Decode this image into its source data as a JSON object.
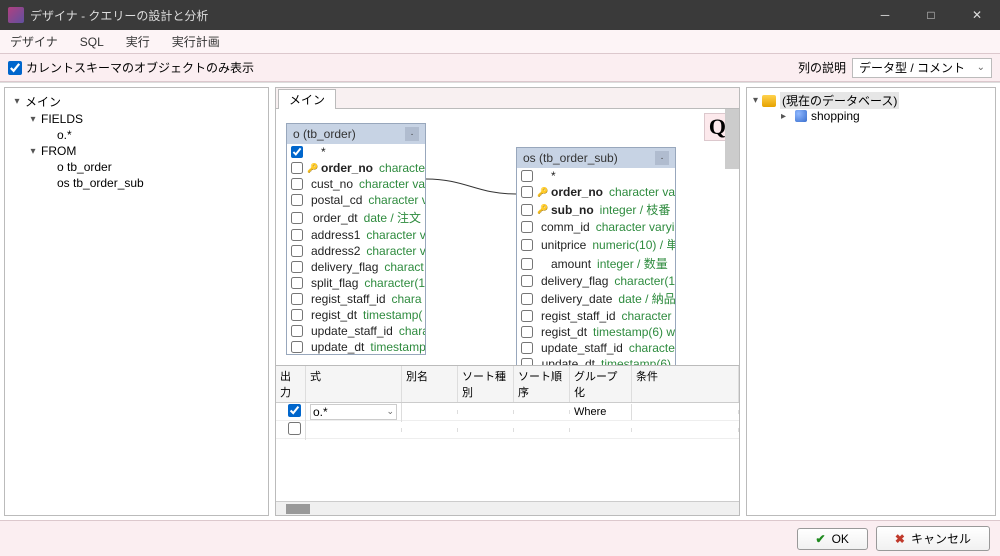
{
  "window": {
    "title": "デザイナ - クエリーの設計と分析"
  },
  "menu": {
    "designer": "デザイナ",
    "sql": "SQL",
    "run": "実行",
    "plan": "実行計画"
  },
  "toolbar": {
    "show_current_schema": "カレントスキーマのオブジェクトのみ表示",
    "column_desc_label": "列の説明",
    "column_desc_value": "データ型 / コメント"
  },
  "left_tree": {
    "main": "メイン",
    "fields": "FIELDS",
    "ostar": "o.*",
    "from": "FROM",
    "t1": "o tb_order",
    "t2": "os tb_order_sub"
  },
  "center": {
    "tab": "メイン"
  },
  "card_o": {
    "header": "o (tb_order)",
    "cols": [
      {
        "name": "*",
        "type": "",
        "key": false,
        "checked": true
      },
      {
        "name": "order_no",
        "type": "character v",
        "key": true,
        "bold": true
      },
      {
        "name": "cust_no",
        "type": "character va",
        "key": false
      },
      {
        "name": "postal_cd",
        "type": "character v",
        "key": false
      },
      {
        "name": "order_dt",
        "type": "date / 注文",
        "key": false
      },
      {
        "name": "address1",
        "type": "character v",
        "key": false
      },
      {
        "name": "address2",
        "type": "character v",
        "key": false
      },
      {
        "name": "delivery_flag",
        "type": "charact",
        "key": false
      },
      {
        "name": "split_flag",
        "type": "character(1",
        "key": false
      },
      {
        "name": "regist_staff_id",
        "type": "chara",
        "key": false
      },
      {
        "name": "regist_dt",
        "type": "timestamp(",
        "key": false
      },
      {
        "name": "update_staff_id",
        "type": "chara",
        "key": false
      },
      {
        "name": "update_dt",
        "type": "timestamp",
        "key": false
      }
    ]
  },
  "card_os": {
    "header": "os (tb_order_sub)",
    "cols": [
      {
        "name": "*",
        "type": "",
        "key": false
      },
      {
        "name": "order_no",
        "type": "character vary",
        "key": true,
        "bold": true
      },
      {
        "name": "sub_no",
        "type": "integer / 枝番",
        "key": true,
        "bold": true
      },
      {
        "name": "comm_id",
        "type": "character varyi",
        "key": false
      },
      {
        "name": "unitprice",
        "type": "numeric(10) / 単",
        "key": false
      },
      {
        "name": "amount",
        "type": "integer / 数量",
        "key": false
      },
      {
        "name": "delivery_flag",
        "type": "character(1",
        "key": false
      },
      {
        "name": "delivery_date",
        "type": "date / 納品",
        "key": false
      },
      {
        "name": "regist_staff_id",
        "type": "character",
        "key": false
      },
      {
        "name": "regist_dt",
        "type": "timestamp(6) w",
        "key": false
      },
      {
        "name": "update_staff_id",
        "type": "characte",
        "key": false
      },
      {
        "name": "update_dt",
        "type": "timestamp(6)",
        "key": false
      }
    ]
  },
  "grid": {
    "headers": {
      "out": "出力",
      "expr": "式",
      "alias": "別名",
      "sortk": "ソート種別",
      "sorto": "ソート順序",
      "group": "グループ化",
      "cond": "条件"
    },
    "row1": {
      "expr": "o.*",
      "group": "Where"
    }
  },
  "right": {
    "root": "(現在のデータベース)",
    "child": "shopping"
  },
  "buttons": {
    "ok": "OK",
    "cancel": "キャンセル"
  }
}
